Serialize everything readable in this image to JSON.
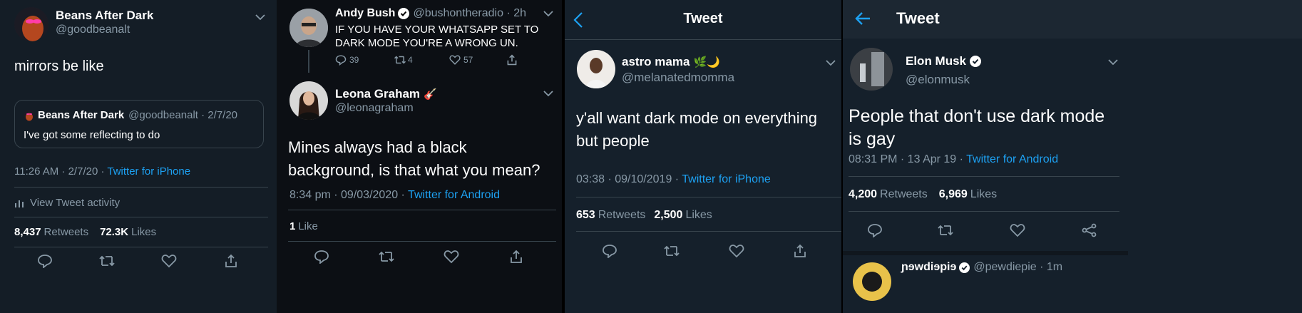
{
  "panel1": {
    "author_name": "Beans After Dark",
    "author_handle": "@goodbeanalt",
    "tweet_text": "mirrors be like",
    "quote": {
      "name": "Beans After Dark",
      "meta": "@goodbeanalt · 2/7/20",
      "text": "I've got some reflecting to do"
    },
    "time": "11:26 AM · 2/7/20 · ",
    "source": "Twitter for iPhone",
    "activity_label": "View Tweet activity",
    "retweets_count": "8,437",
    "retweets_label": "Retweets",
    "likes_count": "72.3K",
    "likes_label": "Likes"
  },
  "panel2": {
    "reply_to": {
      "name": "Andy Bush",
      "meta": "@bushontheradio · 2h",
      "text": "IF YOU HAVE YOUR WHATSAPP SET TO DARK MODE YOU'RE A WRONG UN.",
      "reply_count": "39",
      "retweet_count": "4",
      "like_count": "57"
    },
    "author_name": "Leona Graham",
    "author_emoji": "🎸",
    "author_handle": "@leonagraham",
    "tweet_text": "Mines always had a black background, is that what you mean?",
    "time": "8:34 pm · 09/03/2020 · ",
    "source": "Twitter for Android",
    "likes_count": "1",
    "likes_label": "Like"
  },
  "panel3": {
    "header_title": "Tweet",
    "author_name": "astro mama",
    "author_emoji": "🌿🌙",
    "author_handle": "@melanatedmomma",
    "tweet_text": "y'all want dark mode on everything but people",
    "time": "03:38 · 09/10/2019 · ",
    "source": "Twitter for iPhone",
    "retweets_count": "653",
    "retweets_label": "Retweets",
    "likes_count": "2,500",
    "likes_label": "Likes"
  },
  "panel4": {
    "header_title": "Tweet",
    "author_name": "Elon Musk",
    "author_handle": "@elonmusk",
    "tweet_text": "People that don't use dark mode is gay",
    "time": "08:31 PM · 13 Apr 19 · ",
    "source": "Twitter for Android",
    "retweets_count": "4,200",
    "retweets_label": "Retweets",
    "likes_count": "6,969",
    "likes_label": "Likes",
    "next_tweet": {
      "name": "ɲɘwdiɘpiɘ",
      "meta": "@pewdiepie · 1m"
    }
  },
  "colors": {
    "accent": "#1da1f2",
    "panel1_bg": "#15202b",
    "panel2_bg": "#0c0f14",
    "panel3_bg": "#15202b",
    "panel4_bg": "#15202b",
    "secondary_text": "#8899a6"
  }
}
